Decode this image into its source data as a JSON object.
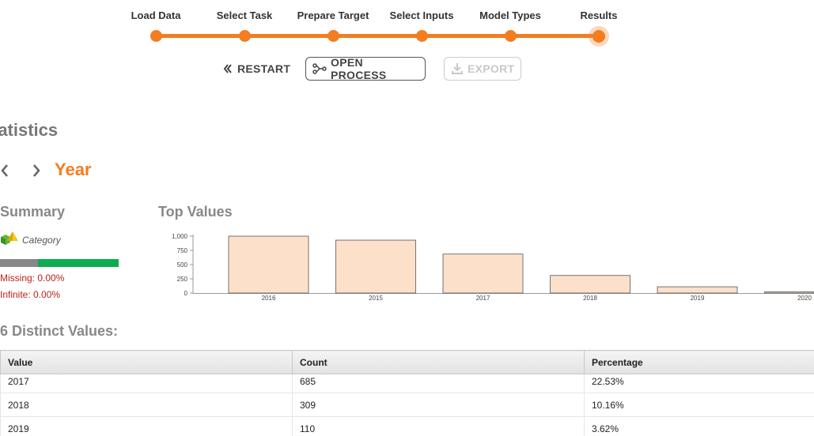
{
  "wizard": {
    "steps": [
      {
        "label": "Load Data"
      },
      {
        "label": "Select Task"
      },
      {
        "label": "Prepare Target"
      },
      {
        "label": "Select Inputs"
      },
      {
        "label": "Model Types"
      },
      {
        "label": "Results"
      }
    ],
    "active_step": "Results",
    "accent_color": "#f47d20"
  },
  "toolbar": {
    "restart_label": "RESTART",
    "open_process_label": "OPEN PROCESS",
    "export_label": "EXPORT"
  },
  "page": {
    "section_title": "tatistics",
    "attribute_name": "Year"
  },
  "summary": {
    "title": "Summary",
    "type_label": "Category",
    "missing_fraction": 0.0,
    "missing_text": "Missing: 0.00%",
    "infinite_text": "Infinite: 0.00%"
  },
  "top_values": {
    "title": "Top Values"
  },
  "chart_data": {
    "type": "bar",
    "categories": [
      "2016",
      "2015",
      "2017",
      "2018",
      "2019",
      "2020"
    ],
    "values": [
      1000,
      930,
      685,
      309,
      110,
      15
    ],
    "yticks": [
      "1,000",
      "750",
      "500",
      "250",
      "0"
    ],
    "ytick_values": [
      1000,
      750,
      500,
      250,
      0
    ],
    "ylim": [
      0,
      1000
    ],
    "bar_color": "#fde0ca",
    "bar_stroke": "#555555"
  },
  "distinct": {
    "title": "6 Distinct Values:",
    "columns": [
      "Value",
      "Count",
      "Percentage"
    ],
    "rows": [
      [
        "2017",
        "685",
        "22.53%"
      ],
      [
        "2018",
        "309",
        "10.16%"
      ],
      [
        "2019",
        "110",
        "3.62%"
      ]
    ]
  }
}
